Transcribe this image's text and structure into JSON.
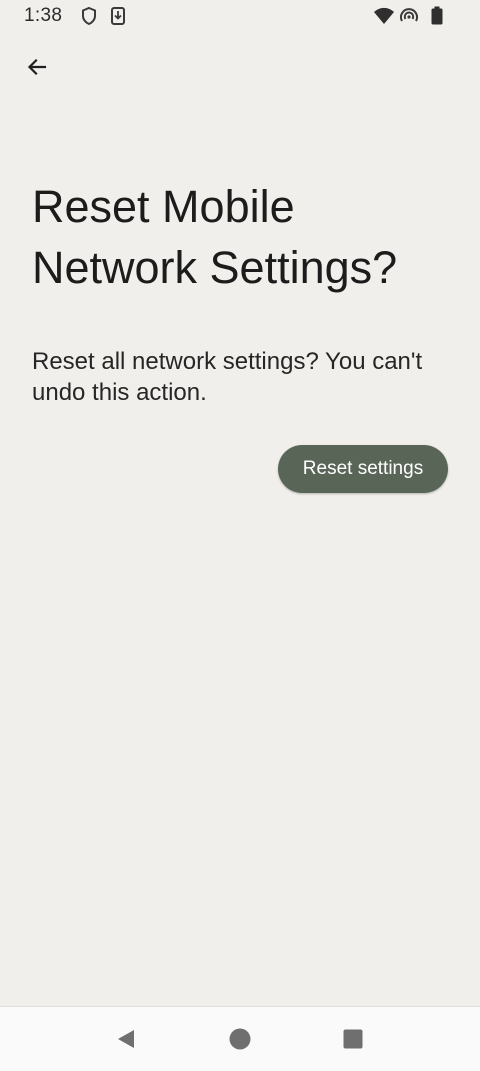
{
  "status_bar": {
    "time": "1:38",
    "left_icons": [
      "shield-icon",
      "download-icon"
    ],
    "right_icons": [
      "wifi-icon",
      "hotspot-icon",
      "battery-icon"
    ]
  },
  "toolbar": {
    "back_icon": "arrow-left-icon"
  },
  "main": {
    "title": "Reset Mobile Network Settings?",
    "description": "Reset all network settings? You can't undo this action.",
    "reset_button_label": "Reset settings"
  },
  "nav_bar": {
    "items": [
      "back-triangle-icon",
      "home-circle-icon",
      "recents-square-icon"
    ]
  },
  "colors": {
    "background": "#f1efeb",
    "accent": "#596657",
    "nav_background": "#fafafa"
  }
}
